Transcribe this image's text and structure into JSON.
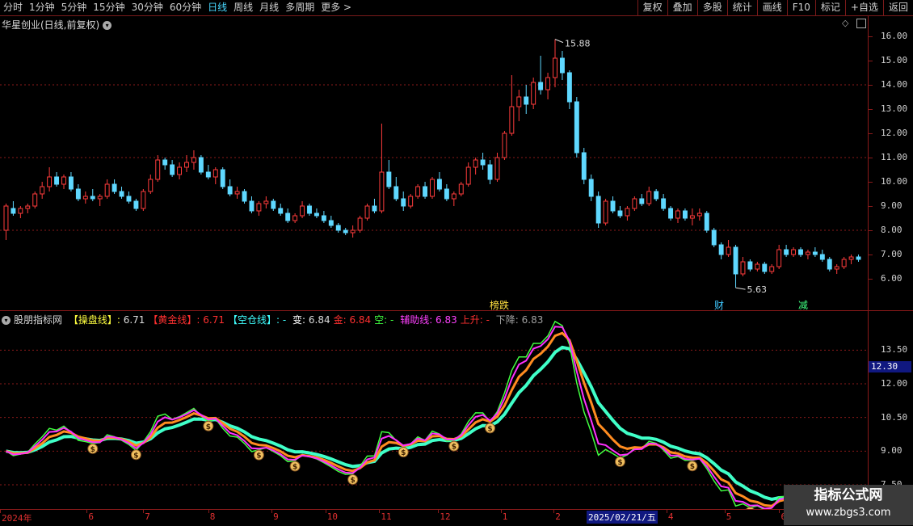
{
  "toolbar": {
    "periods": [
      "分时",
      "1分钟",
      "5分钟",
      "15分钟",
      "30分钟",
      "60分钟",
      "日线",
      "周线",
      "月线",
      "多周期",
      "更多 >"
    ],
    "active_period": "日线",
    "actions": [
      "复权",
      "叠加",
      "多股",
      "统计",
      "画线",
      "F10",
      "标记",
      "+自选",
      "返回"
    ]
  },
  "main_panel": {
    "title": "华星创业(日线,前复权)",
    "high_label": "15.88",
    "low_label": "5.63",
    "markers": [
      "榜跌",
      "财",
      "减"
    ],
    "y_ticks": [
      "16.00",
      "15.00",
      "14.00",
      "13.00",
      "12.00",
      "11.00",
      "10.00",
      "9.00",
      "8.00",
      "7.00",
      "6.00"
    ],
    "y_range": [
      5.0,
      16.5
    ],
    "candles": [
      [
        8.0,
        9.1,
        7.6,
        9.0
      ],
      [
        8.9,
        9.2,
        8.6,
        8.7
      ],
      [
        8.7,
        9.0,
        8.5,
        8.9
      ],
      [
        8.9,
        9.1,
        8.7,
        9.0
      ],
      [
        9.0,
        9.6,
        8.9,
        9.5
      ],
      [
        9.5,
        10.0,
        9.3,
        9.8
      ],
      [
        9.8,
        10.6,
        9.6,
        10.2
      ],
      [
        10.2,
        10.4,
        9.8,
        9.9
      ],
      [
        9.9,
        10.3,
        9.7,
        10.2
      ],
      [
        10.2,
        10.4,
        9.6,
        9.7
      ],
      [
        9.7,
        9.9,
        9.2,
        9.3
      ],
      [
        9.3,
        9.6,
        9.1,
        9.4
      ],
      [
        9.4,
        9.7,
        9.2,
        9.3
      ],
      [
        9.3,
        9.5,
        9.0,
        9.4
      ],
      [
        9.4,
        10.1,
        9.3,
        9.9
      ],
      [
        9.9,
        10.1,
        9.5,
        9.6
      ],
      [
        9.6,
        9.8,
        9.3,
        9.4
      ],
      [
        9.4,
        9.6,
        9.1,
        9.2
      ],
      [
        9.2,
        9.3,
        8.8,
        8.9
      ],
      [
        8.9,
        9.7,
        8.8,
        9.6
      ],
      [
        9.6,
        10.3,
        9.5,
        10.1
      ],
      [
        10.1,
        11.1,
        10.0,
        10.9
      ],
      [
        10.9,
        11.0,
        10.5,
        10.7
      ],
      [
        10.7,
        10.9,
        10.2,
        10.3
      ],
      [
        10.3,
        10.8,
        10.1,
        10.6
      ],
      [
        10.6,
        11.1,
        10.4,
        10.8
      ],
      [
        10.8,
        11.3,
        10.5,
        11.0
      ],
      [
        11.0,
        11.1,
        10.3,
        10.4
      ],
      [
        10.4,
        10.7,
        10.1,
        10.2
      ],
      [
        10.2,
        10.6,
        9.9,
        10.5
      ],
      [
        10.5,
        10.6,
        9.7,
        9.8
      ],
      [
        9.8,
        10.1,
        9.4,
        9.5
      ],
      [
        9.5,
        9.8,
        9.3,
        9.6
      ],
      [
        9.6,
        9.7,
        9.1,
        9.2
      ],
      [
        9.2,
        9.4,
        8.7,
        8.8
      ],
      [
        8.8,
        9.2,
        8.6,
        9.1
      ],
      [
        9.1,
        9.4,
        8.9,
        9.2
      ],
      [
        9.2,
        9.3,
        8.8,
        8.9
      ],
      [
        8.9,
        9.1,
        8.6,
        8.7
      ],
      [
        8.7,
        8.9,
        8.3,
        8.4
      ],
      [
        8.4,
        8.7,
        8.3,
        8.6
      ],
      [
        8.6,
        9.2,
        8.5,
        9.0
      ],
      [
        9.0,
        9.1,
        8.6,
        8.7
      ],
      [
        8.7,
        8.9,
        8.5,
        8.6
      ],
      [
        8.6,
        8.8,
        8.3,
        8.4
      ],
      [
        8.4,
        8.6,
        8.1,
        8.2
      ],
      [
        8.2,
        8.3,
        7.9,
        8.0
      ],
      [
        8.0,
        8.1,
        7.8,
        7.9
      ],
      [
        7.9,
        8.2,
        7.7,
        8.0
      ],
      [
        8.0,
        8.6,
        7.9,
        8.5
      ],
      [
        8.5,
        9.1,
        8.4,
        9.0
      ],
      [
        9.0,
        9.3,
        8.7,
        8.8
      ],
      [
        8.8,
        12.4,
        8.7,
        10.4
      ],
      [
        10.4,
        10.9,
        9.7,
        9.8
      ],
      [
        9.8,
        10.2,
        9.2,
        9.3
      ],
      [
        9.3,
        9.6,
        8.8,
        9.0
      ],
      [
        9.0,
        9.5,
        8.9,
        9.4
      ],
      [
        9.4,
        9.9,
        9.3,
        9.8
      ],
      [
        9.8,
        10.0,
        9.3,
        9.4
      ],
      [
        9.4,
        10.2,
        9.3,
        10.1
      ],
      [
        10.1,
        10.4,
        9.6,
        9.7
      ],
      [
        9.7,
        9.9,
        9.2,
        9.3
      ],
      [
        9.3,
        9.6,
        9.0,
        9.5
      ],
      [
        9.5,
        10.0,
        9.4,
        9.9
      ],
      [
        9.9,
        10.8,
        9.8,
        10.6
      ],
      [
        10.6,
        11.0,
        10.3,
        10.9
      ],
      [
        10.9,
        11.2,
        10.5,
        10.7
      ],
      [
        10.7,
        10.9,
        9.9,
        10.1
      ],
      [
        10.1,
        11.2,
        10.0,
        11.0
      ],
      [
        11.0,
        12.1,
        10.9,
        12.0
      ],
      [
        12.0,
        14.4,
        11.9,
        13.1
      ],
      [
        13.1,
        13.8,
        12.5,
        13.5
      ],
      [
        13.5,
        14.0,
        12.8,
        13.2
      ],
      [
        13.2,
        14.3,
        13.0,
        14.1
      ],
      [
        14.1,
        15.2,
        13.6,
        13.8
      ],
      [
        13.8,
        14.5,
        13.4,
        14.3
      ],
      [
        14.3,
        15.88,
        13.9,
        15.1
      ],
      [
        15.1,
        15.4,
        14.2,
        14.5
      ],
      [
        14.5,
        14.6,
        13.0,
        13.3
      ],
      [
        13.3,
        13.5,
        11.0,
        11.2
      ],
      [
        11.2,
        11.4,
        9.9,
        10.1
      ],
      [
        10.1,
        10.3,
        9.2,
        9.4
      ],
      [
        9.4,
        9.6,
        8.1,
        8.3
      ],
      [
        8.3,
        9.3,
        8.2,
        9.2
      ],
      [
        9.2,
        9.4,
        8.7,
        8.8
      ],
      [
        8.8,
        9.0,
        8.5,
        8.6
      ],
      [
        8.6,
        9.0,
        8.4,
        8.9
      ],
      [
        8.9,
        9.4,
        8.8,
        9.3
      ],
      [
        9.3,
        9.5,
        9.0,
        9.1
      ],
      [
        9.1,
        9.8,
        9.0,
        9.6
      ],
      [
        9.6,
        9.7,
        9.2,
        9.3
      ],
      [
        9.3,
        9.5,
        8.8,
        8.9
      ],
      [
        8.9,
        9.0,
        8.4,
        8.5
      ],
      [
        8.5,
        8.9,
        8.3,
        8.8
      ],
      [
        8.8,
        8.9,
        8.4,
        8.5
      ],
      [
        8.5,
        8.9,
        8.2,
        8.6
      ],
      [
        8.6,
        8.9,
        8.4,
        8.7
      ],
      [
        8.7,
        8.8,
        7.9,
        8.0
      ],
      [
        8.0,
        8.1,
        7.3,
        7.4
      ],
      [
        7.4,
        7.5,
        6.8,
        7.0
      ],
      [
        7.0,
        7.6,
        6.9,
        7.3
      ],
      [
        7.3,
        7.4,
        5.63,
        6.2
      ],
      [
        6.2,
        6.9,
        6.1,
        6.7
      ],
      [
        6.7,
        6.8,
        6.3,
        6.4
      ],
      [
        6.4,
        6.7,
        6.3,
        6.6
      ],
      [
        6.6,
        6.7,
        6.2,
        6.3
      ],
      [
        6.3,
        6.6,
        6.2,
        6.5
      ],
      [
        6.5,
        7.4,
        6.4,
        7.2
      ],
      [
        7.2,
        7.4,
        6.9,
        7.0
      ],
      [
        7.0,
        7.3,
        6.9,
        7.2
      ],
      [
        7.2,
        7.3,
        6.9,
        7.0
      ],
      [
        7.0,
        7.2,
        6.8,
        7.1
      ],
      [
        7.1,
        7.3,
        6.9,
        7.0
      ],
      [
        7.0,
        7.2,
        6.7,
        6.8
      ],
      [
        6.8,
        6.9,
        6.3,
        6.4
      ],
      [
        6.4,
        6.6,
        6.2,
        6.5
      ],
      [
        6.5,
        6.9,
        6.4,
        6.8
      ],
      [
        6.8,
        7.0,
        6.6,
        6.9
      ],
      [
        6.9,
        7.0,
        6.7,
        6.8
      ]
    ]
  },
  "indicator_panel": {
    "name": "股朋指标网",
    "legend": [
      {
        "label": "【操盘线】: ",
        "value": "6.71",
        "color": "#ffff40"
      },
      {
        "label": "【黄金线】: ",
        "value": "6.71",
        "color": "#ff3030"
      },
      {
        "label": "【空仓线】: - ",
        "value": "",
        "color": "#40ffff"
      },
      {
        "label": "变: ",
        "value": "6.84",
        "color": "#ffffff"
      },
      {
        "label": "金: ",
        "value": "6.84",
        "color": "#ff3030"
      },
      {
        "label": "空: - ",
        "value": "",
        "color": "#40ff40"
      },
      {
        "label": "辅助线: ",
        "value": "6.83",
        "color": "#ff40ff"
      },
      {
        "label": "上升: - ",
        "value": "",
        "color": "#ff3030"
      },
      {
        "label": "下降: ",
        "value": "6.83",
        "color": "#a0a0a0"
      }
    ],
    "y_ticks": [
      "13.50",
      "12.00",
      "10.50",
      "9.00",
      "7.50"
    ],
    "y_range": [
      6.6,
      14.7
    ],
    "current_value": "12.30",
    "buy_marker_icon": "money-bag-icon",
    "buy_marker_glyph": "$"
  },
  "x_axis": {
    "labels": [
      {
        "text": "2024年",
        "pos": 0.0
      },
      {
        "text": "6",
        "pos": 0.1
      },
      {
        "text": "7",
        "pos": 0.165
      },
      {
        "text": "8",
        "pos": 0.24
      },
      {
        "text": "9",
        "pos": 0.313
      },
      {
        "text": "10",
        "pos": 0.375
      },
      {
        "text": "11",
        "pos": 0.437
      },
      {
        "text": "12",
        "pos": 0.505
      },
      {
        "text": "1",
        "pos": 0.577
      },
      {
        "text": "2",
        "pos": 0.638
      },
      {
        "text": "4",
        "pos": 0.768
      },
      {
        "text": "5",
        "pos": 0.835
      },
      {
        "text": "6",
        "pos": 0.898
      }
    ],
    "cursor_date": "2025/02/21/五"
  },
  "watermark": {
    "line1": "指标公式网",
    "line2": "www.zbgs3.com"
  },
  "colors": {
    "up": "#ff3c3c",
    "down": "#5fd8ff",
    "grid": "#8a1a1a"
  }
}
